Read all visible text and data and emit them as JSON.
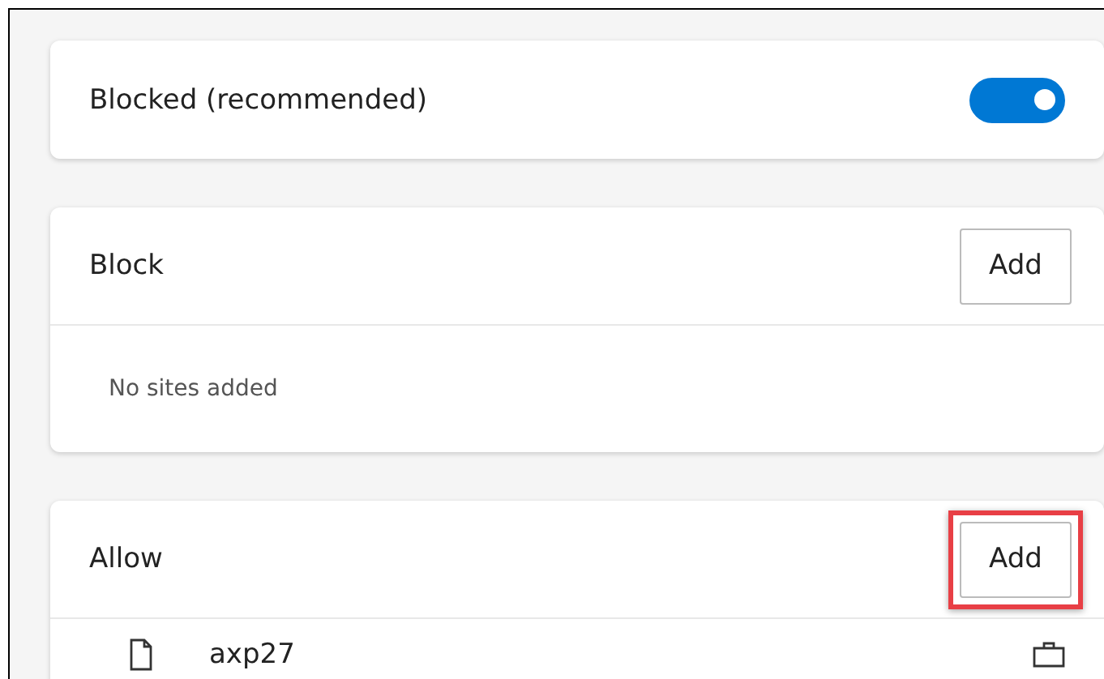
{
  "blocked_card": {
    "label": "Blocked (recommended)",
    "on": true
  },
  "sections": [
    {
      "title": "Block",
      "add_button": {
        "label": "Add",
        "highlighted": false
      },
      "empty_text": "No sites added"
    },
    {
      "title": "Allow",
      "add_button": {
        "label": "Add",
        "highlighted": true
      },
      "sites": [
        {
          "name": "axp27"
        }
      ]
    }
  ]
}
